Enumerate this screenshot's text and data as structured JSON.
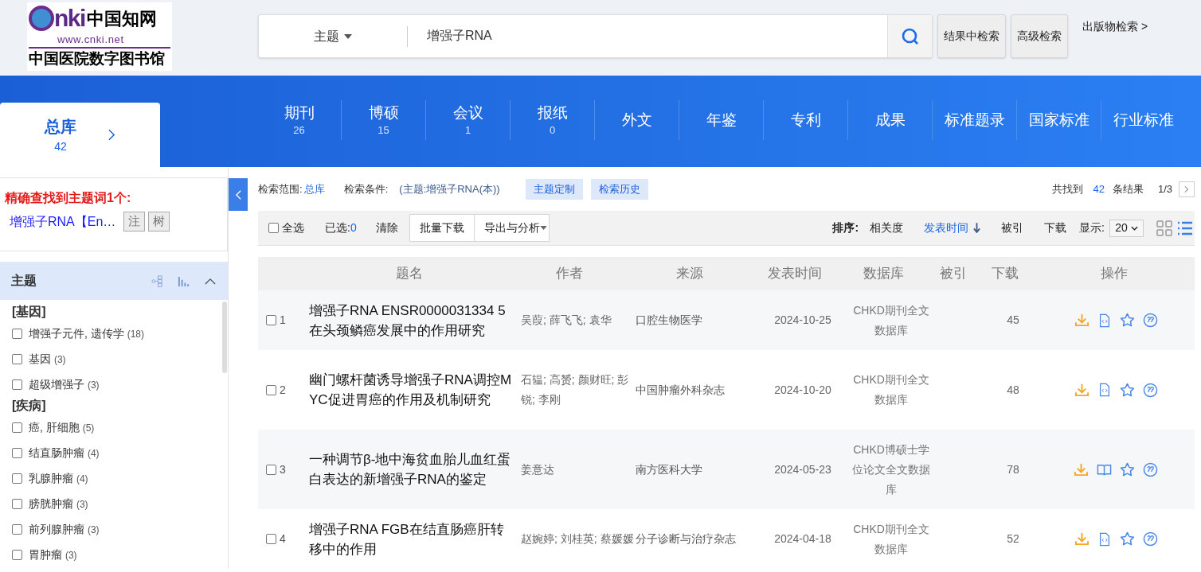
{
  "logo": {
    "brand": "nki",
    "brand_cn": "中国知网",
    "url": "www.cnki.net",
    "library": "中国医院数字图书馆"
  },
  "search": {
    "field": "主题",
    "value": "增强子RNA",
    "buttons": [
      "结果中检索",
      "高级检索"
    ],
    "publication_link": "出版物检索 >"
  },
  "databases": [
    {
      "label": "总库",
      "count": "42",
      "selected": true
    },
    {
      "label": "期刊",
      "count": "26",
      "selected": false
    },
    {
      "label": "博硕",
      "count": "15",
      "selected": false
    },
    {
      "label": "会议",
      "count": "1",
      "selected": false
    },
    {
      "label": "报纸",
      "count": "0",
      "selected": false
    },
    {
      "label": "外文",
      "selected": false
    },
    {
      "label": "年鉴",
      "selected": false
    },
    {
      "label": "专利",
      "selected": false
    },
    {
      "label": "成果",
      "selected": false
    },
    {
      "label": "标准题录",
      "selected": false
    },
    {
      "label": "国家标准",
      "selected": false
    },
    {
      "label": "行业标准",
      "selected": false
    }
  ],
  "topic_box": {
    "title": "精确查找到主题词1个:",
    "term": "增强子RNA【En…",
    "buttons": [
      "注",
      "树"
    ]
  },
  "facet": {
    "title": "主题",
    "expanded": true,
    "groups": [
      {
        "heading": "[基因]",
        "items": [
          {
            "label": "增强子元件, 遗传学",
            "count": "(18)",
            "checked": false
          },
          {
            "label": "基因",
            "count": "(3)",
            "checked": false
          },
          {
            "label": "超级增强子",
            "count": "(3)",
            "checked": false
          }
        ]
      },
      {
        "heading": "[疾病]",
        "items": [
          {
            "label": "癌, 肝细胞",
            "count": "(5)",
            "checked": false
          },
          {
            "label": "结直肠肿瘤",
            "count": "(4)",
            "checked": false
          },
          {
            "label": "乳腺肿瘤",
            "count": "(4)",
            "checked": false
          },
          {
            "label": "膀胱肿瘤",
            "count": "(3)",
            "checked": false
          },
          {
            "label": "前列腺肿瘤",
            "count": "(3)",
            "checked": false
          },
          {
            "label": "胃肿瘤",
            "count": "(3)",
            "checked": false
          }
        ]
      }
    ]
  },
  "criteria": {
    "scope_label": "检索范围:",
    "scope": "总库",
    "condition_label": "检索条件:",
    "condition": "(主题:增强子RNA(本))",
    "buttons": [
      "主题定制",
      "检索历史"
    ],
    "found_prefix": "共找到",
    "found_count": "42",
    "found_suffix": "条结果",
    "page": "1/3"
  },
  "toolbar": {
    "select_all": "全选",
    "select_all_checked": false,
    "selected_label": "已选:",
    "selected_count": "0",
    "clear": "清除",
    "batch_download": "批量下载",
    "export": "导出与分析",
    "sort_label": "排序:",
    "sort_options": [
      {
        "label": "相关度",
        "selected": false
      },
      {
        "label": "发表时间",
        "selected": true
      },
      {
        "label": "被引",
        "selected": false
      },
      {
        "label": "下载",
        "selected": false
      }
    ],
    "display_label": "显示:",
    "page_size": "20",
    "view_modes": [
      {
        "kind": "grid",
        "selected": false
      },
      {
        "kind": "list",
        "selected": true
      }
    ]
  },
  "table": {
    "columns": [
      "题名",
      "作者",
      "来源",
      "发表时间",
      "数据库",
      "被引",
      "下载",
      "操作"
    ],
    "rows": [
      {
        "index": "1",
        "checked": false,
        "kind": "html",
        "title": "增强子RNA ENSR0000031334 5在头颈鳞癌发展中的作用研究",
        "authors": "吴葭; 薛飞飞; 袁华",
        "source": "口腔生物医学",
        "date": "2024-10-25",
        "database": "CHKD期刊全文数据库",
        "downloads": "45"
      },
      {
        "index": "2",
        "checked": false,
        "kind": "html",
        "title": "幽门螺杆菌诱导增强子RNA调控MYC促进胃癌的作用及机制研究",
        "authors": "石韫; 高赟; 颜财旺; 彭锐; 李刚",
        "source": "中国肿瘤外科杂志",
        "date": "2024-10-20",
        "database": "CHKD期刊全文数据库",
        "downloads": "48"
      },
      {
        "index": "3",
        "checked": false,
        "kind": "book",
        "title": "一种调节β-地中海贫血胎儿血红蛋白表达的新增强子RNA的鉴定",
        "authors": "姜意达",
        "source": "南方医科大学",
        "date": "2024-05-23",
        "database": "CHKD博硕士学位论文全文数据库",
        "downloads": "78"
      },
      {
        "index": "4",
        "checked": false,
        "kind": "html",
        "title": "增强子RNA FGB在结直肠癌肝转移中的作用",
        "authors": "赵婉婷; 刘桂英; 蔡媛媛",
        "source": "分子诊断与治疗杂志",
        "date": "2024-04-18",
        "database": "CHKD期刊全文数据库",
        "downloads": "52"
      }
    ]
  }
}
